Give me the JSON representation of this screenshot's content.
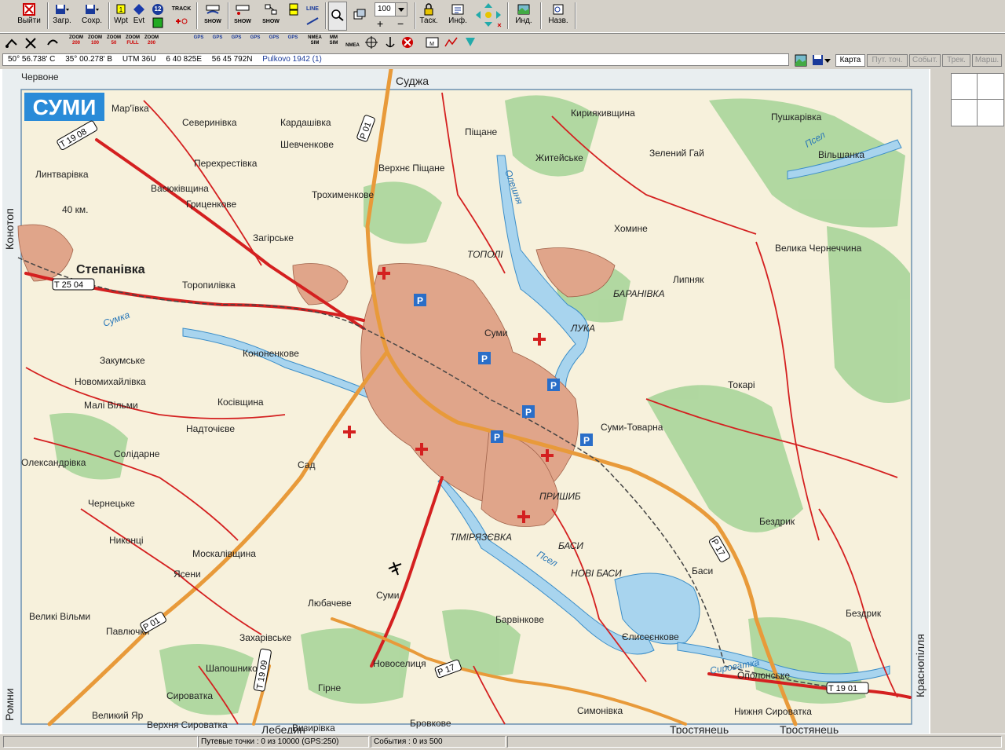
{
  "toolbar": {
    "exit": "Выйти",
    "load": "Загр.",
    "save": "Сохр.",
    "wpt": "Wpt",
    "evt": "Evt",
    "badge": "12",
    "track": "TRACK",
    "show1": "SHOW",
    "show2": "SHOW",
    "show3": "SHOW",
    "line": "LINE",
    "zoom_value": "100",
    "task": "Таск.",
    "info": "Инф.",
    "ind": "Инд.",
    "names": "Назв."
  },
  "toolbar2": {
    "zoom1": [
      "ZOOM",
      "200"
    ],
    "zoom2": [
      "ZOOM",
      "100"
    ],
    "zoom3": [
      "ZOOM",
      "50"
    ],
    "zoom4": [
      "ZOOM",
      "FULL"
    ],
    "zoom5": [
      "ZOOM",
      "200"
    ],
    "gps1": "GPS",
    "gps2": "GPS",
    "gps3": "GPS",
    "gps4": "GPS",
    "gps5": "GPS",
    "gps6": "GPS",
    "nmea1": [
      "NMEA",
      "SIM"
    ],
    "mm": [
      "MM",
      "SIM"
    ],
    "nmea2": "NMEA"
  },
  "coords": {
    "lat": "50° 56.738' С",
    "lon": "35° 00.278' В",
    "utm": "UTM  36U",
    "easting": "6 40 825E",
    "northing": "56 45 792N",
    "datum": "Pulkovo 1942 (1)"
  },
  "tabs": {
    "map": "Карта",
    "waypoints": "Пут. точ.",
    "events": "Событ.",
    "track": "Трек.",
    "route": "Марш."
  },
  "status": {
    "waypoints": "Путевые точки : 0 из 10000  (GPS:250)",
    "events": "События : 0 из 500"
  },
  "map": {
    "title": "СУМИ",
    "border_labels": {
      "top": "Суджа",
      "left_top": "Конотоп",
      "left_bottom": "Ромни",
      "right_bottom": "Краснопілля",
      "bottom1": "Лебедин",
      "bottom2": "Тростянець",
      "bottom3": "Тростянець"
    },
    "places": [
      "Мар'ївка",
      "Северинівка",
      "Кардашівка",
      "Шевченкове",
      "Перехрестівка",
      "Линтварівка",
      "Васюківщина",
      "Гриценкове",
      "Загірське",
      "Степанівка",
      "Торопилівка",
      "Піщане",
      "Верхнє Піщане",
      "Трохименкове",
      "Кириякивщина",
      "Житейське",
      "Зелений Гай",
      "Пушкарівка",
      "Вільшанка",
      "Хомине",
      "Велика Чернеччина",
      "ТОПОЛІ",
      "БАРАНІВКА",
      "Липняк",
      "ЛУКА",
      "Суми",
      "Кононенкове",
      "Закумське",
      "Новомихайлівка",
      "Малі Вільми",
      "Косівщина",
      "Надточієве",
      "Токарі",
      "Олександрівка",
      "Солідарне",
      "Сад",
      "Суми-Товарна",
      "Чернецьке",
      "Никонці",
      "ПРИШИБ",
      "Бездрик",
      "Москалівщина",
      "ТІМІРЯЗЄВКА",
      "БАСИ",
      "Ясени",
      "НОВІ БАСИ",
      "Баси",
      "Любачеве",
      "Суми",
      "Великі Вільми",
      "Павлючки",
      "Барвінкове",
      "Бездрик",
      "Захарівське",
      "Єлисеєнкове",
      "Новоселиця",
      "Шапошникове",
      "Гірне",
      "Ополонське",
      "Сироватка",
      "Великий Яр",
      "Симонівка",
      "Нижня Сироватка",
      "Верхня Сироватка",
      "Визирівка",
      "Бровкове",
      "Червоне"
    ],
    "roads": [
      "T 19 08",
      "T 25 04",
      "P 01",
      "P 01",
      "P 17",
      "P 17",
      "T 19 09",
      "T 19 01"
    ],
    "rivers": [
      "Олешня",
      "Сумка",
      "Псел",
      "Псел",
      "Сироватка"
    ],
    "distance_marker": "40 км."
  }
}
